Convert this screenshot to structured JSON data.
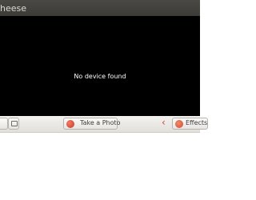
{
  "window": {
    "title": "heese"
  },
  "preview": {
    "message": "No device found"
  },
  "toolbar": {
    "take_photo_label": "Take a Photo",
    "effects_label": "Effects",
    "prev_icon": "chevron-left-icon"
  },
  "colors": {
    "titlebar": "#3c3b37",
    "preview_bg": "#000000",
    "record_red": "#d0482c",
    "toolbar_bg": "#ebeae7"
  }
}
